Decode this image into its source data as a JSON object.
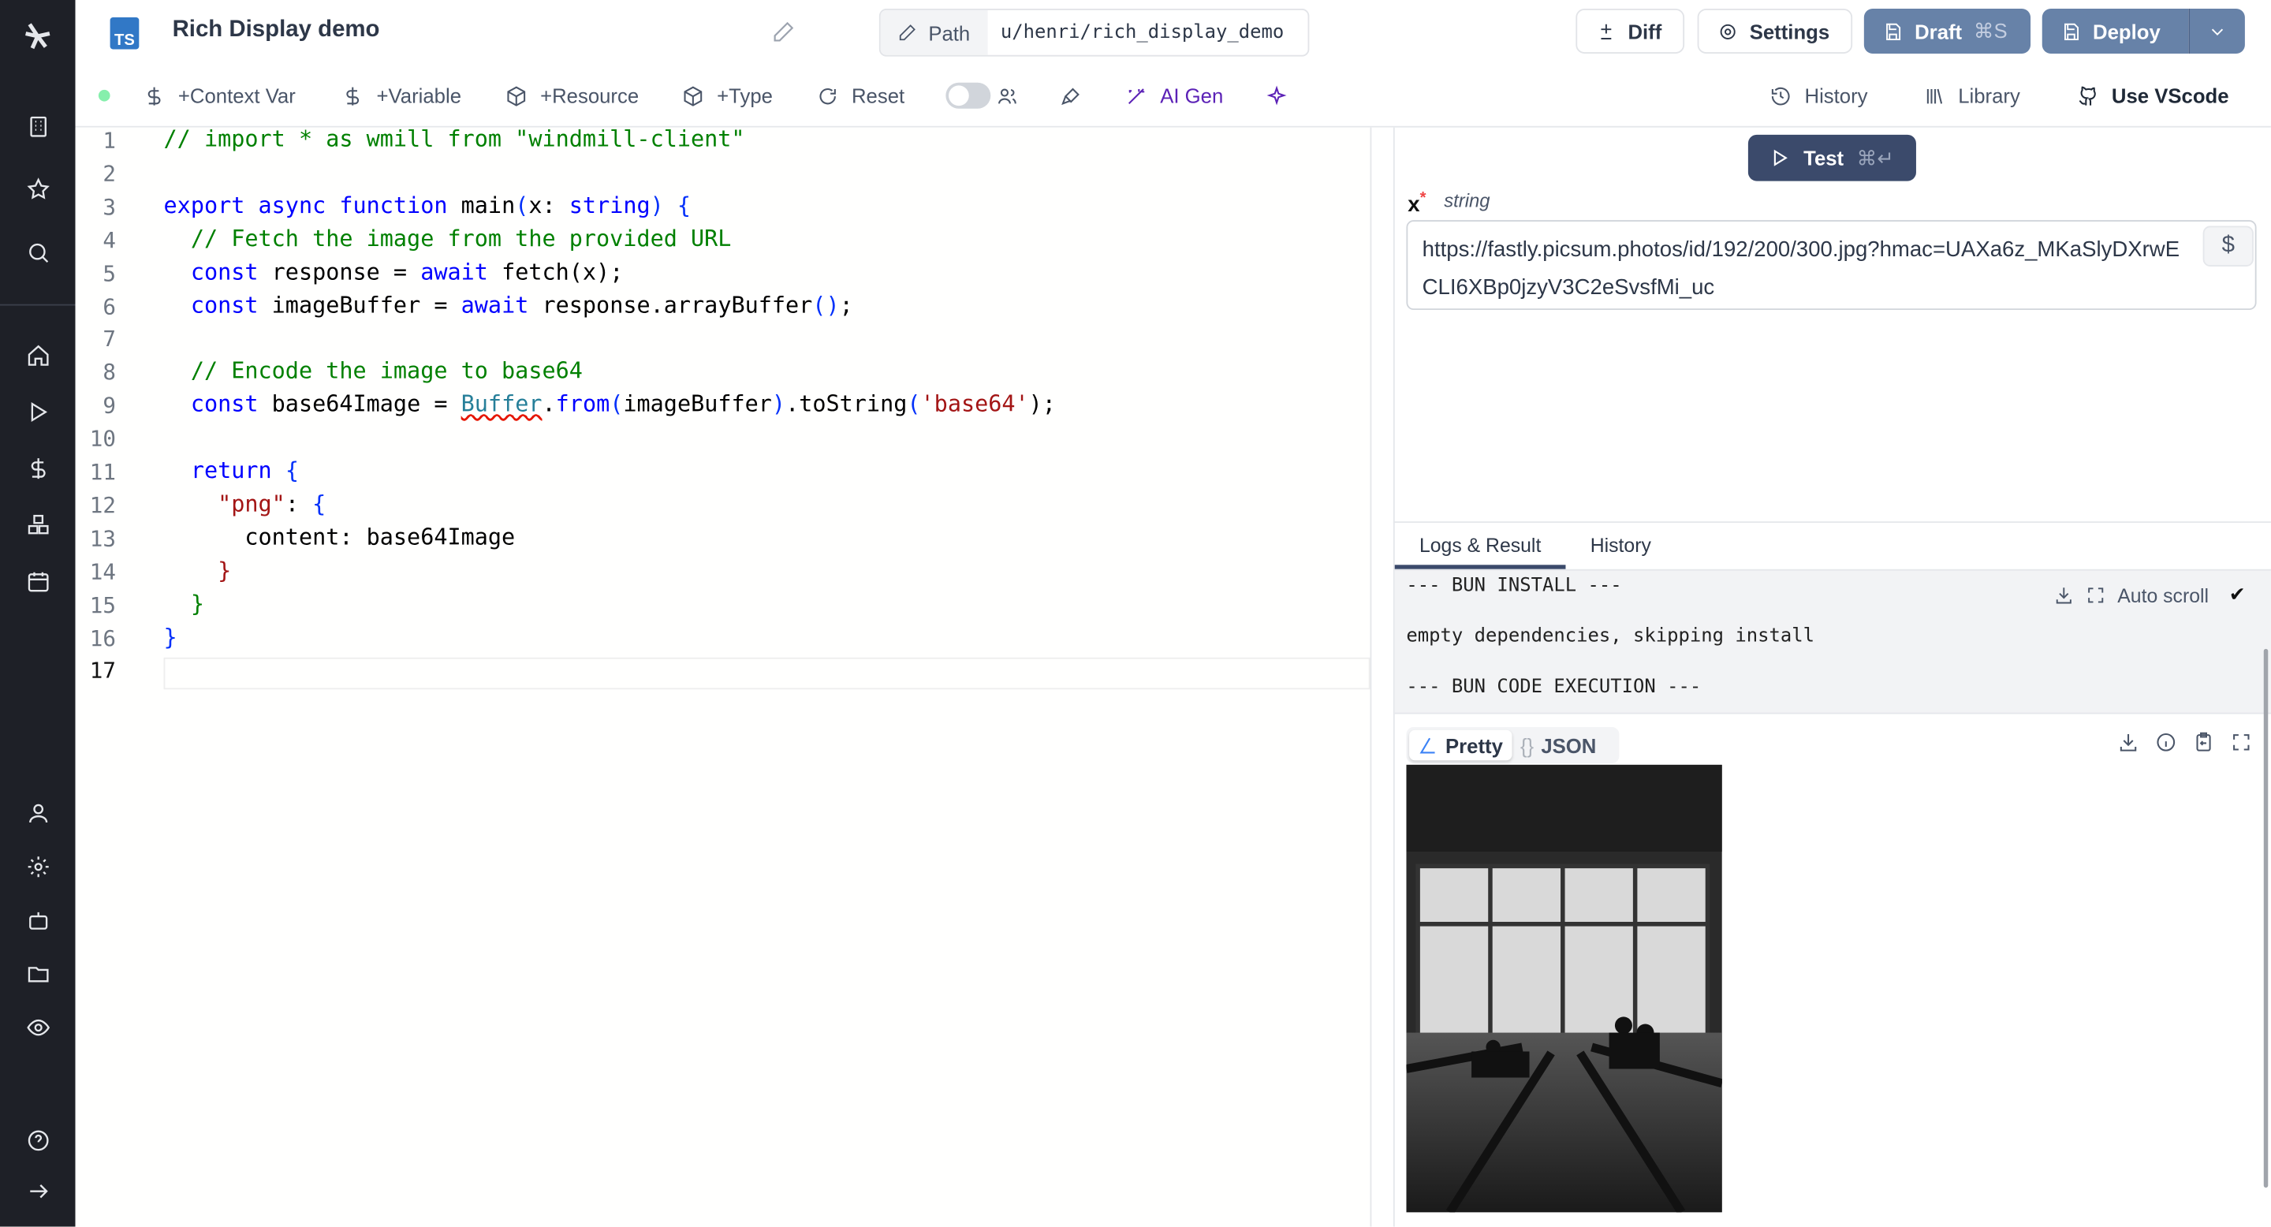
{
  "header": {
    "language_badge": "TS",
    "title": "Rich Display demo",
    "path_label": "Path",
    "path_value": "u/henri/rich_display_demo",
    "diff_label": "Diff",
    "settings_label": "Settings",
    "draft_label": "Draft",
    "draft_shortcut": "⌘S",
    "deploy_label": "Deploy"
  },
  "toolbar": {
    "status_color": "#86efac",
    "context_var": "+Context Var",
    "variable": "+Variable",
    "resource": "+Resource",
    "type": "+Type",
    "reset": "Reset",
    "multiplayer_toggle": false,
    "ai_gen": "AI Gen",
    "history": "History",
    "library": "Library",
    "use_vscode": "Use VScode"
  },
  "editor": {
    "line_numbers": [
      "1",
      "2",
      "3",
      "4",
      "5",
      "6",
      "7",
      "8",
      "9",
      "10",
      "11",
      "12",
      "13",
      "14",
      "15",
      "16",
      "17"
    ],
    "current_line": "17",
    "lines": [
      [
        {
          "t": "// import * as wmill from \"windmill-client\"",
          "c": "cm"
        }
      ],
      [],
      [
        {
          "t": "export async function ",
          "c": "kw"
        },
        {
          "t": "main",
          "c": ""
        },
        {
          "t": "(",
          "c": "pr"
        },
        {
          "t": "x: ",
          "c": ""
        },
        {
          "t": "string",
          "c": "kw"
        },
        {
          "t": ") {",
          "c": "pr"
        }
      ],
      [
        {
          "t": "  // Fetch the image from the provided URL",
          "c": "cm"
        }
      ],
      [
        {
          "t": "  const ",
          "c": "kw"
        },
        {
          "t": "response = ",
          "c": ""
        },
        {
          "t": "await ",
          "c": "kw"
        },
        {
          "t": "fetch(x);",
          "c": ""
        }
      ],
      [
        {
          "t": "  const ",
          "c": "kw"
        },
        {
          "t": "imageBuffer = ",
          "c": ""
        },
        {
          "t": "await ",
          "c": "kw"
        },
        {
          "t": "response.arrayBuffer",
          "c": ""
        },
        {
          "t": "()",
          "c": "pr"
        },
        {
          "t": ";",
          "c": ""
        }
      ],
      [],
      [
        {
          "t": "  // Encode the image to base64",
          "c": "cm"
        }
      ],
      [
        {
          "t": "  const ",
          "c": "kw"
        },
        {
          "t": "base64Image = ",
          "c": ""
        },
        {
          "t": "Buffer",
          "c": "ty sq"
        },
        {
          "t": ".",
          "c": ""
        },
        {
          "t": "from",
          "c": "kw"
        },
        {
          "t": "(",
          "c": "pr"
        },
        {
          "t": "imageBuffer",
          "c": ""
        },
        {
          "t": ")",
          "c": "pr"
        },
        {
          "t": ".toString",
          "c": ""
        },
        {
          "t": "(",
          "c": "pr"
        },
        {
          "t": "'base64'",
          "c": "st"
        },
        {
          "t": ");",
          "c": ""
        }
      ],
      [],
      [
        {
          "t": "  return ",
          "c": "kw"
        },
        {
          "t": "{",
          "c": "pr"
        }
      ],
      [
        {
          "t": "    ",
          "c": ""
        },
        {
          "t": "\"png\"",
          "c": "st"
        },
        {
          "t": ": ",
          "c": ""
        },
        {
          "t": "{",
          "c": "pr"
        }
      ],
      [
        {
          "t": "      content: base64Image",
          "c": ""
        }
      ],
      [
        {
          "t": "    }",
          "c": "st"
        }
      ],
      [
        {
          "t": "  }",
          "c": "cm"
        }
      ],
      [
        {
          "t": "}",
          "c": "pr"
        }
      ],
      []
    ]
  },
  "run": {
    "test_label": "Test",
    "test_shortcut": "⌘↵",
    "arg_name": "x",
    "arg_required": "*",
    "arg_type": "string",
    "arg_value": "https://fastly.picsum.photos/id/192/200/300.jpg?hmac=UAXa6z_MKaSlyDXrwECLI6XBp0jzyV3C2eSvsfMi_uc",
    "arg_button": "$"
  },
  "results": {
    "tabs": [
      {
        "label": "Logs & Result",
        "active": true
      },
      {
        "label": "History",
        "active": false
      }
    ],
    "logs": [
      "--- BUN INSTALL ---",
      "empty dependencies, skipping install",
      "--- BUN CODE EXECUTION ---"
    ],
    "auto_scroll_label": "Auto scroll",
    "auto_scroll_checked": "✔",
    "view_pretty": "Pretty",
    "view_json": "JSON",
    "json_icon": "{}"
  }
}
